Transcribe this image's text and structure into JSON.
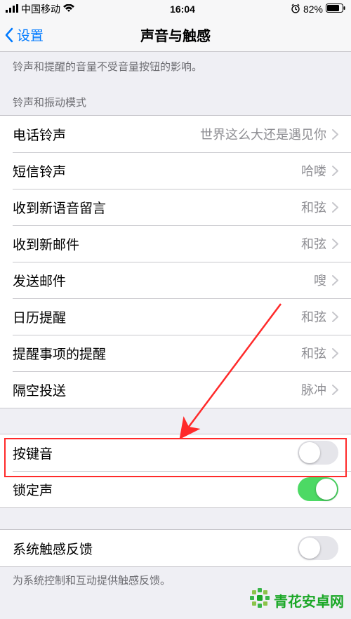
{
  "status": {
    "carrier": "中国移动",
    "time": "16:04",
    "battery": "82%"
  },
  "nav": {
    "back": "设置",
    "title": "声音与触感"
  },
  "hint_top": "铃声和提醒的音量不受音量按钮的影响。",
  "section1_header": "铃声和振动模式",
  "rows1": [
    {
      "label": "电话铃声",
      "value": "世界这么大还是遇见你"
    },
    {
      "label": "短信铃声",
      "value": "哈喽"
    },
    {
      "label": "收到新语音留言",
      "value": "和弦"
    },
    {
      "label": "收到新邮件",
      "value": "和弦"
    },
    {
      "label": "发送邮件",
      "value": "嗖"
    },
    {
      "label": "日历提醒",
      "value": "和弦"
    },
    {
      "label": "提醒事项的提醒",
      "value": "和弦"
    },
    {
      "label": "隔空投送",
      "value": "脉冲"
    }
  ],
  "toggles": {
    "keyboard": {
      "label": "按键音",
      "on": false
    },
    "lock": {
      "label": "锁定声",
      "on": true
    }
  },
  "haptic": {
    "label": "系统触感反馈",
    "on": false
  },
  "footer_hint": "为系统控制和互动提供触感反馈。",
  "watermark": "青花安卓网"
}
